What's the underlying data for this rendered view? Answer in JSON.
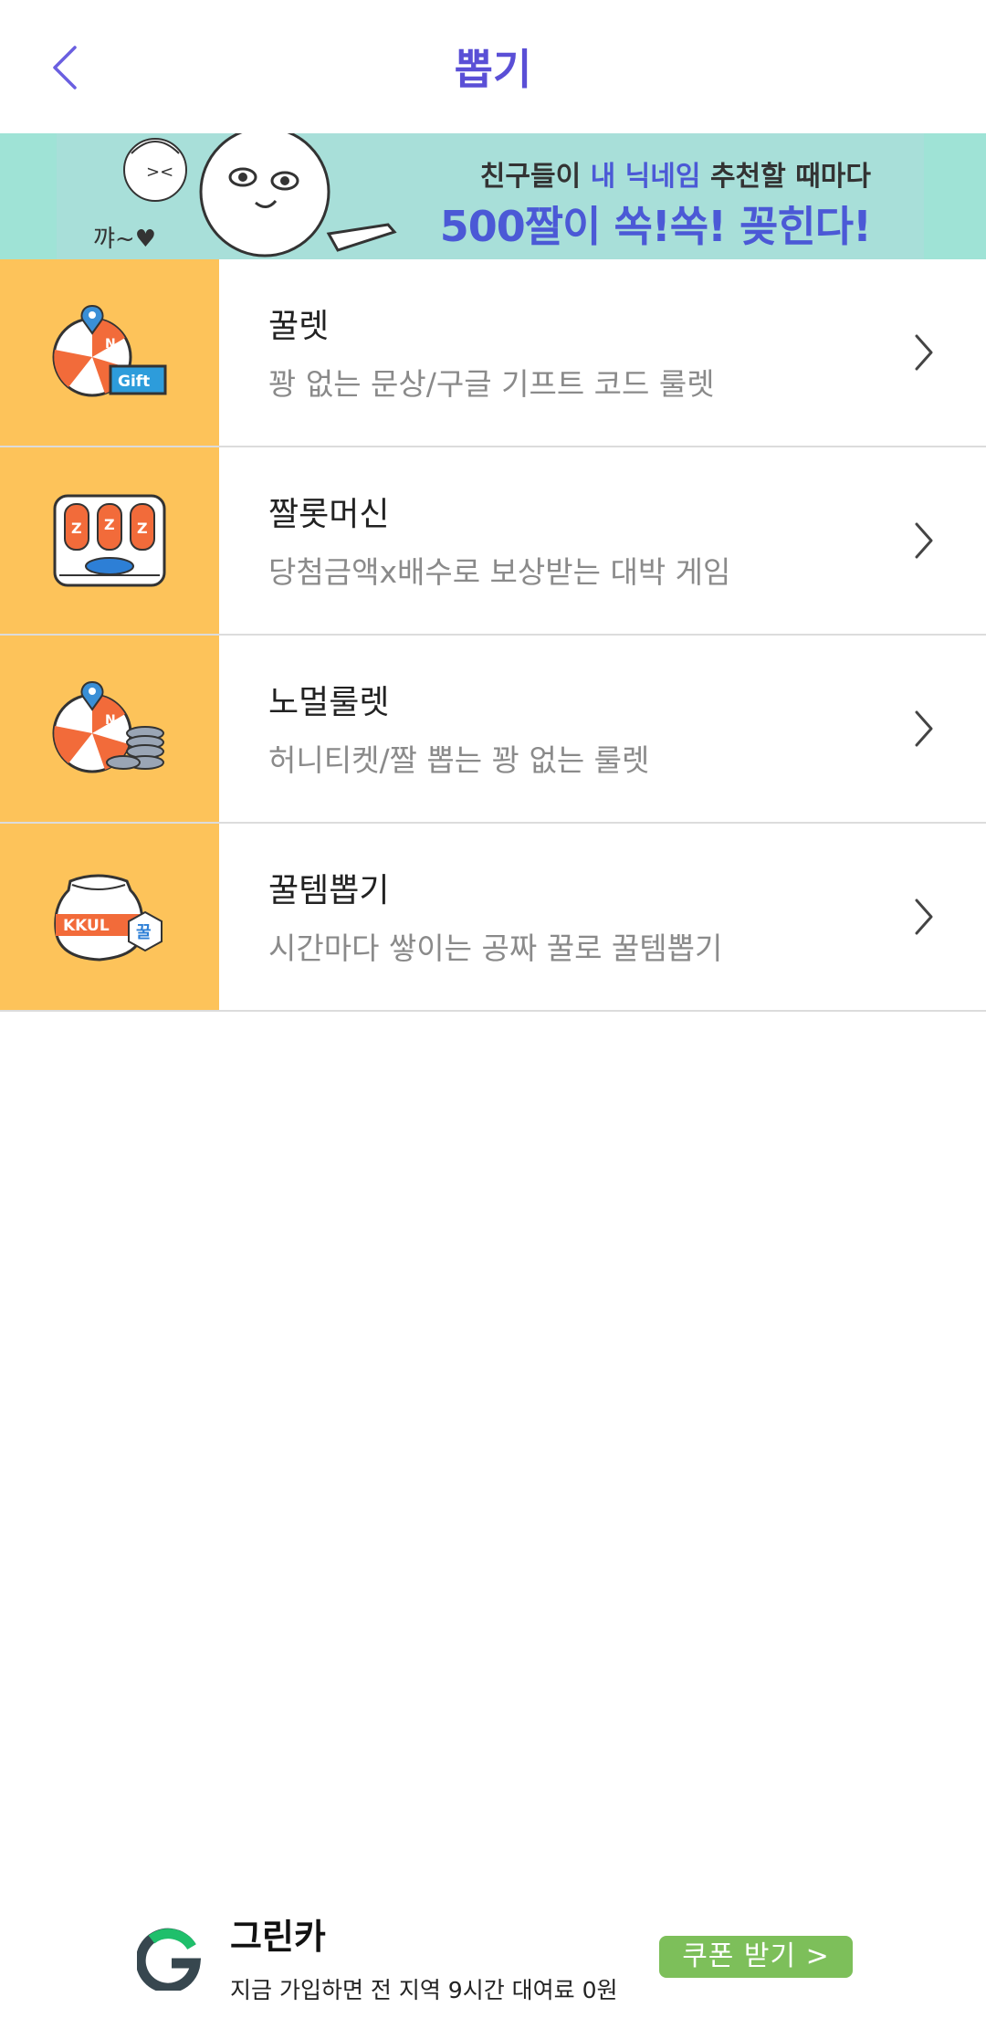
{
  "header": {
    "title": "뽑기"
  },
  "banner": {
    "line1_a": "친구들이 ",
    "line1_highlight": "내 닉네임",
    "line1_b": " 추천할 때마다",
    "line2": "500짤이 쏙!쏙! 꽂힌다!",
    "art_text": "꺄~♥"
  },
  "menu": [
    {
      "label": "꿀렛",
      "description": "꽝 없는 문상/구글 기프트 코드 룰렛",
      "icon": "roulette-gift-icon"
    },
    {
      "label": "짤롯머신",
      "description": "당첨금액x배수로 보상받는 대박 게임",
      "icon": "slot-machine-icon"
    },
    {
      "label": "노멀룰렛",
      "description": "허니티켓/짤 뽑는 꽝 없는 룰렛",
      "icon": "roulette-coins-icon"
    },
    {
      "label": "꿀템뽑기",
      "description": "시간마다 쌓이는 공짜 꿀로 꿀템뽑기",
      "icon": "honey-jar-icon"
    }
  ],
  "icon_text": {
    "gift": "Gift",
    "kkul": "KKUL",
    "kkul_badge": "꿀",
    "z": "Z",
    "n": "N"
  },
  "ad": {
    "title": "그린카",
    "description": "지금 가입하면 전 지역 9시간 대여료 0원",
    "button": "쿠폰 받기 >"
  },
  "colors": {
    "accent": "#5a4fd6",
    "icon_bg": "#fdc35a",
    "banner_bg": "#9fe3d6",
    "ad_button": "#7dbf5a"
  }
}
